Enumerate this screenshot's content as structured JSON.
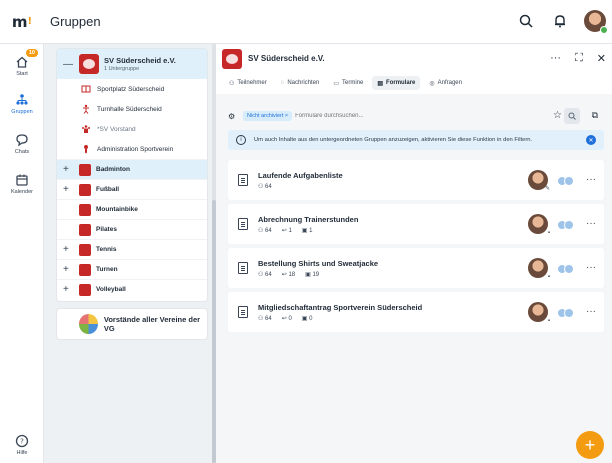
{
  "app": {
    "logo": "m",
    "logo_mark": "!",
    "title": "Gruppen"
  },
  "nav": {
    "items": [
      {
        "label": "Start",
        "icon": "home-icon",
        "badge": "10"
      },
      {
        "label": "Gruppen",
        "icon": "groups-icon"
      },
      {
        "label": "Chats",
        "icon": "chat-icon"
      },
      {
        "label": "Kalender",
        "icon": "calendar-icon"
      },
      {
        "label": "Hilfe",
        "icon": "help-icon"
      }
    ]
  },
  "groups": {
    "main": {
      "name": "SV Süderscheid e.V.",
      "sub": "1 Untergruppe"
    },
    "subitems": [
      {
        "label": "Sportplatz Süderscheid"
      },
      {
        "label": "Turnhalle Süderscheid"
      },
      {
        "label": "*SV Vorstand"
      },
      {
        "label": "Administration Sportverein"
      }
    ],
    "items": [
      {
        "label": "Badminton"
      },
      {
        "label": "Fußball"
      },
      {
        "label": "Mountainbike"
      },
      {
        "label": "Pilates"
      },
      {
        "label": "Tennis"
      },
      {
        "label": "Turnen"
      },
      {
        "label": "Volleyball"
      }
    ],
    "vg": "Vorstände aller Vereine der VG"
  },
  "main": {
    "title": "SV Süderscheid e.V.",
    "tabs": [
      {
        "label": "Teilnehmer"
      },
      {
        "label": "Nachrichten"
      },
      {
        "label": "Termine"
      },
      {
        "label": "Formulare"
      },
      {
        "label": "Anfragen"
      }
    ],
    "filter": {
      "chip": "Nicht archiviert ×",
      "placeholder": "Formulare durchsuchen..."
    },
    "info": "Um auch Inhalte aus den untergeordneten Gruppen anzuzeigen, aktivieren Sie diese Funktion in den Filtern.",
    "forms": [
      {
        "title": "Laufende Aufgabenliste",
        "participants": "64"
      },
      {
        "title": "Abrechnung Trainerstunden",
        "participants": "64",
        "replies": "1",
        "files": "1"
      },
      {
        "title": "Bestellung Shirts und Sweatjacke",
        "participants": "64",
        "replies": "18",
        "files": "19"
      },
      {
        "title": "Mitgliedschaftantrag Sportverein Süderscheid",
        "participants": "64",
        "replies": "0",
        "files": "0"
      }
    ]
  },
  "colors": {
    "accent": "#1e6fd9",
    "badge": "#f39c12",
    "group_red": "#c62828"
  }
}
